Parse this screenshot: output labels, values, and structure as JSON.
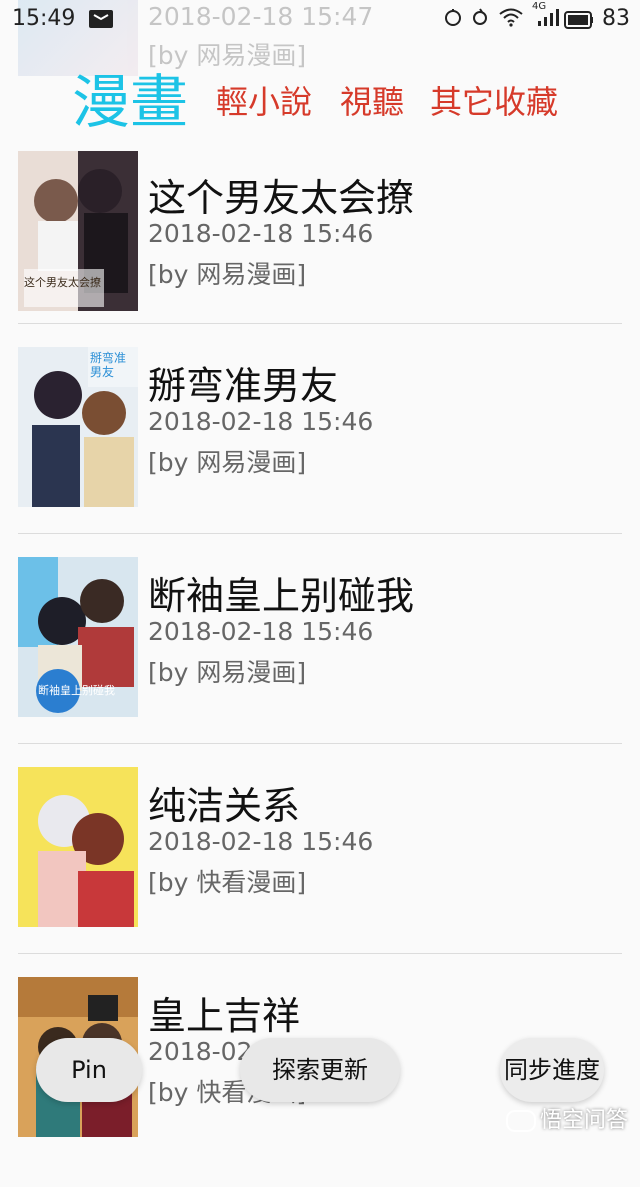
{
  "status_bar": {
    "time": "15:49",
    "network": "4G",
    "battery_percent": "83",
    "icons": [
      "notification-icon",
      "alarm-icon",
      "sync-icon",
      "wifi-icon",
      "signal-icon",
      "battery-icon"
    ]
  },
  "previous_item": {
    "date": "2018-02-18 15:47",
    "source": "[by 网易漫画]"
  },
  "tabs": [
    {
      "label": "漫畫",
      "active": true
    },
    {
      "label": "輕小說",
      "active": false
    },
    {
      "label": "視聽",
      "active": false
    },
    {
      "label": "其它收藏",
      "active": false
    }
  ],
  "comics": [
    {
      "title": "这个男友太会撩",
      "date": "2018-02-18 15:46",
      "source": "[by 网易漫画]",
      "cover_caption": "这个男友太会撩"
    },
    {
      "title": "掰弯准男友",
      "date": "2018-02-18 15:46",
      "source": "[by 网易漫画]",
      "cover_caption": "掰弯准男友"
    },
    {
      "title": "断袖皇上别碰我",
      "date": "2018-02-18 15:46",
      "source": "[by 网易漫画]",
      "cover_caption": "断袖皇上别碰我"
    },
    {
      "title": "纯洁关系",
      "date": "2018-02-18 15:46",
      "source": "[by 快看漫画]",
      "cover_caption": ""
    },
    {
      "title": "皇上吉祥",
      "date": "2018-02-18 15:46",
      "source": "[by 快看漫画]",
      "cover_caption": ""
    }
  ],
  "buttons": {
    "pin": "Pin",
    "explore": "探索更新",
    "sync": "同步進度"
  },
  "watermark": "悟空问答",
  "colors": {
    "active_tab": "#1cc3e6",
    "inactive_tab": "#d63a2a",
    "background": "#fafafa"
  }
}
